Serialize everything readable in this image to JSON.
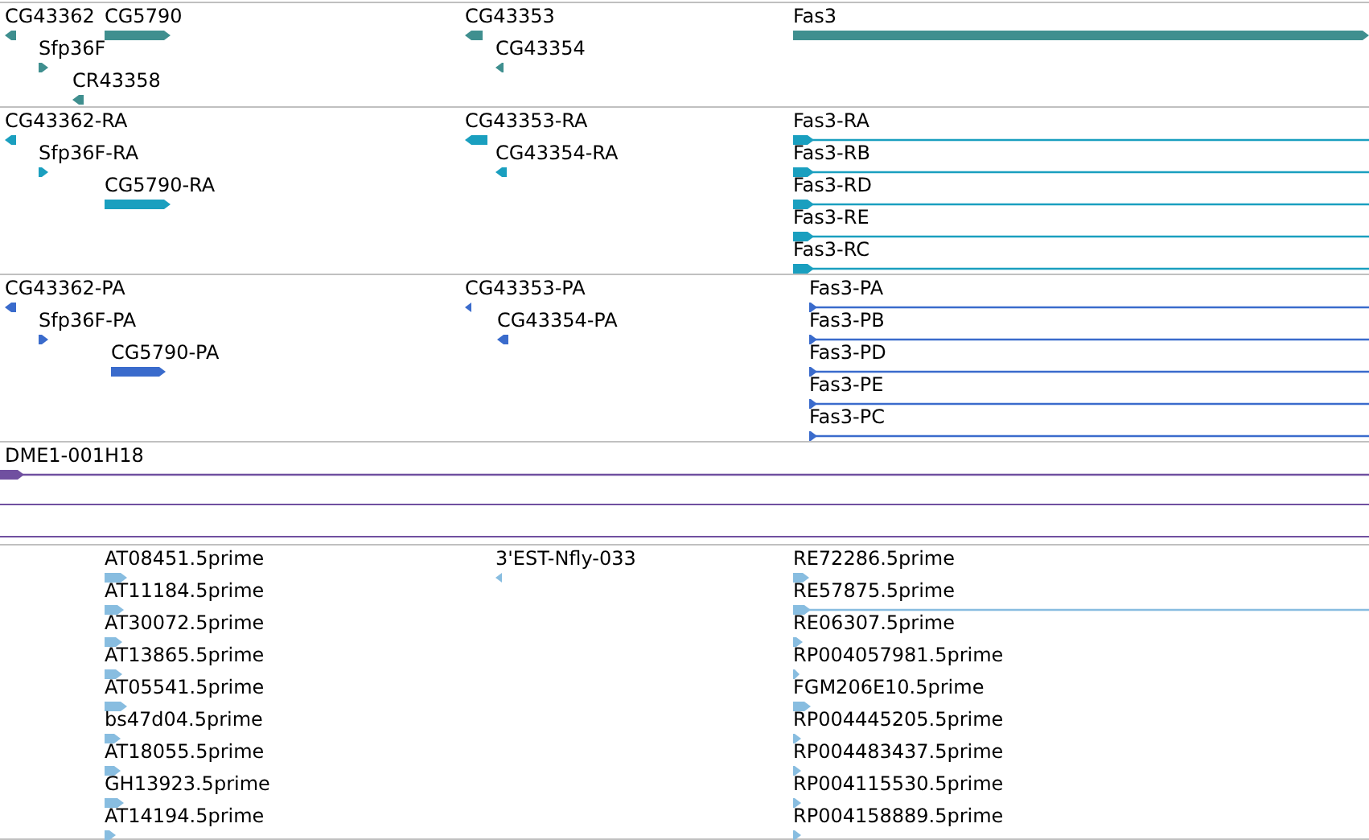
{
  "tracks": [
    {
      "color": "#3f8f8f",
      "features": [
        {
          "label": "CG43362",
          "reverse": true,
          "kind": "gene"
        },
        {
          "label": "CG5790",
          "reverse": false,
          "kind": "gene"
        },
        {
          "label": "Sfp36F",
          "reverse": false,
          "kind": "gene"
        },
        {
          "label": "CR43358",
          "reverse": true,
          "kind": "gene"
        },
        {
          "label": "CG43353",
          "reverse": true,
          "kind": "gene"
        },
        {
          "label": "CG43354",
          "reverse": true,
          "kind": "gene"
        },
        {
          "label": "Fas3",
          "reverse": false,
          "kind": "gene"
        }
      ]
    },
    {
      "color": "#1a9fbf",
      "features": [
        {
          "label": "CG43362-RA",
          "reverse": true,
          "kind": "gene"
        },
        {
          "label": "Sfp36F-RA",
          "reverse": false,
          "kind": "gene"
        },
        {
          "label": "CG5790-RA",
          "reverse": false,
          "kind": "gene"
        },
        {
          "label": "CG43353-RA",
          "reverse": true,
          "kind": "gene"
        },
        {
          "label": "CG43354-RA",
          "reverse": true,
          "kind": "gene"
        },
        {
          "label": "Fas3-RA",
          "reverse": false,
          "kind": "spliced"
        },
        {
          "label": "Fas3-RB",
          "reverse": false,
          "kind": "spliced"
        },
        {
          "label": "Fas3-RD",
          "reverse": false,
          "kind": "spliced"
        },
        {
          "label": "Fas3-RE",
          "reverse": false,
          "kind": "spliced"
        },
        {
          "label": "Fas3-RC",
          "reverse": false,
          "kind": "spliced"
        }
      ]
    },
    {
      "color": "#3a6bcc",
      "features": [
        {
          "label": "CG43362-PA",
          "reverse": true,
          "kind": "gene"
        },
        {
          "label": "Sfp36F-PA",
          "reverse": false,
          "kind": "gene"
        },
        {
          "label": "CG5790-PA",
          "reverse": false,
          "kind": "gene"
        },
        {
          "label": "CG43353-PA",
          "reverse": true,
          "kind": "gene"
        },
        {
          "label": "CG43354-PA",
          "reverse": true,
          "kind": "gene"
        },
        {
          "label": "Fas3-PA",
          "reverse": false,
          "kind": "spliced"
        },
        {
          "label": "Fas3-PB",
          "reverse": false,
          "kind": "spliced"
        },
        {
          "label": "Fas3-PD",
          "reverse": false,
          "kind": "spliced"
        },
        {
          "label": "Fas3-PE",
          "reverse": false,
          "kind": "spliced"
        },
        {
          "label": "Fas3-PC",
          "reverse": false,
          "kind": "spliced"
        }
      ]
    },
    {
      "color": "#7050a0",
      "features": [
        {
          "label": "DME1-001H18",
          "reverse": false,
          "kind": "spliced"
        }
      ]
    },
    {
      "color": "#88bde0",
      "features": [
        {
          "label": "AT08451.5prime",
          "reverse": false,
          "kind": "gene"
        },
        {
          "label": "AT11184.5prime",
          "reverse": false,
          "kind": "gene"
        },
        {
          "label": "AT30072.5prime",
          "reverse": false,
          "kind": "gene"
        },
        {
          "label": "AT13865.5prime",
          "reverse": false,
          "kind": "gene"
        },
        {
          "label": "AT05541.5prime",
          "reverse": false,
          "kind": "gene"
        },
        {
          "label": "bs47d04.5prime",
          "reverse": false,
          "kind": "gene"
        },
        {
          "label": "AT18055.5prime",
          "reverse": false,
          "kind": "gene"
        },
        {
          "label": "GH13923.5prime",
          "reverse": false,
          "kind": "gene"
        },
        {
          "label": "AT14194.5prime",
          "reverse": false,
          "kind": "gene"
        },
        {
          "label": "3'EST-Nfly-033",
          "reverse": true,
          "kind": "gene"
        },
        {
          "label": "RE72286.5prime",
          "reverse": false,
          "kind": "gene"
        },
        {
          "label": "RE57875.5prime",
          "reverse": false,
          "kind": "spliced"
        },
        {
          "label": "RE06307.5prime",
          "reverse": false,
          "kind": "gene"
        },
        {
          "label": "RP004057981.5prime",
          "reverse": false,
          "kind": "gene"
        },
        {
          "label": "FGM206E10.5prime",
          "reverse": false,
          "kind": "gene"
        },
        {
          "label": "RP004445205.5prime",
          "reverse": false,
          "kind": "gene"
        },
        {
          "label": "RP004483437.5prime",
          "reverse": false,
          "kind": "gene"
        },
        {
          "label": "RP004115530.5prime",
          "reverse": false,
          "kind": "gene"
        },
        {
          "label": "RP004158889.5prime",
          "reverse": false,
          "kind": "gene"
        }
      ]
    }
  ]
}
